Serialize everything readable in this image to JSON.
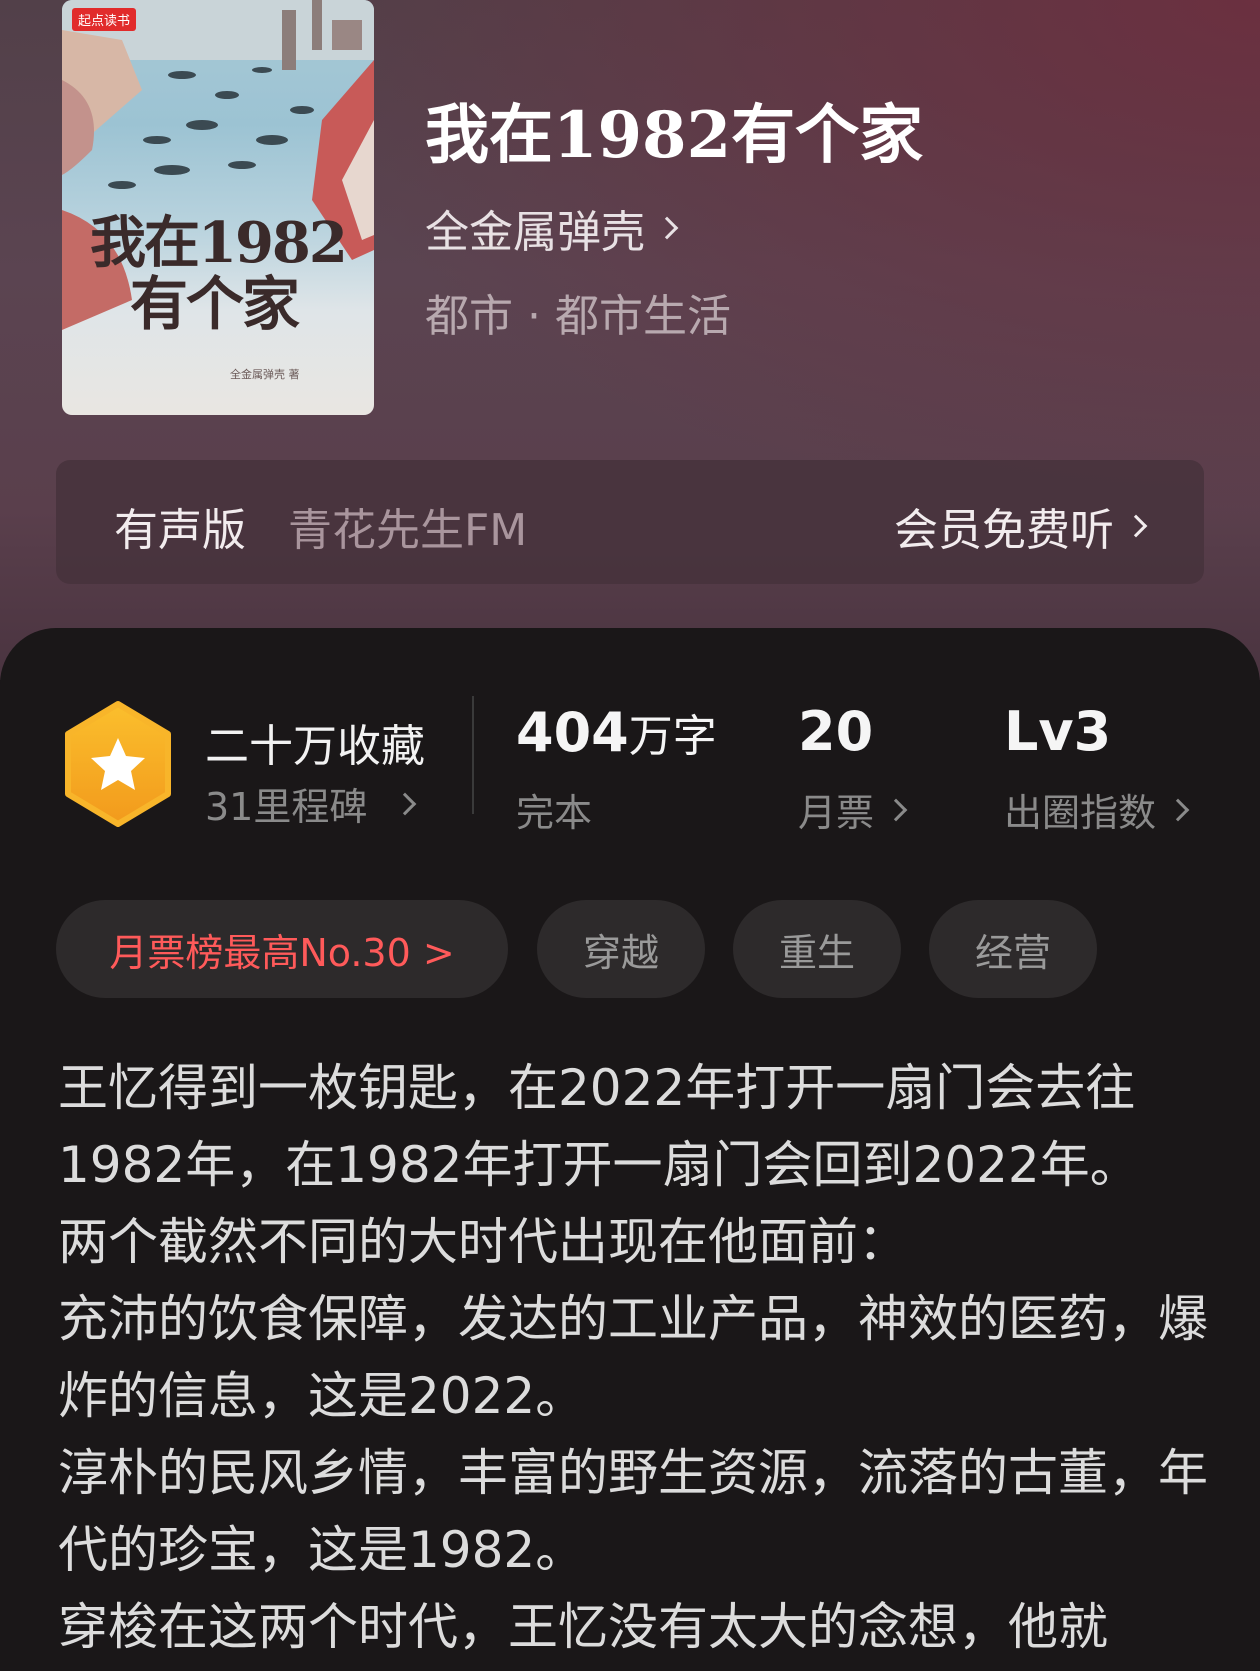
{
  "book": {
    "title": "我在1982有个家",
    "author": "全金属弹壳",
    "genre": "都市 · 都市生活",
    "cover": {
      "brand": "起点读书",
      "title_line1": "我在1982",
      "title_line2": "有个家",
      "author": "全金属弹壳 著"
    }
  },
  "audio": {
    "label": "有声版",
    "narrator": "青花先生FM",
    "action": "会员免费听"
  },
  "stats": {
    "collection": {
      "title": "二十万收藏",
      "milestones": "31里程碑"
    },
    "words": {
      "value": "404",
      "unit": "万字",
      "status": "完本"
    },
    "monthly_ticket": {
      "value": "20",
      "label": "月票"
    },
    "circle_index": {
      "value": "Lv3",
      "label": "出圈指数"
    }
  },
  "tags": {
    "rank": "月票榜最高No.30 >",
    "items": [
      "穿越",
      "重生",
      "经营"
    ]
  },
  "synopsis": [
    "王忆得到一枚钥匙，在2022年打开一扇门会去往1982年，在1982年打开一扇门会回到2022年。",
    "两个截然不同的大时代出现在他面前：",
    "充沛的饮食保障，发达的工业产品，神效的医药，爆炸的信息，这是2022。",
    "淳朴的民风乡情，丰富的野生资源，流落的古董，年代的珍宝，这是1982。",
    "穿梭在这两个时代，王忆没有太大的念想，他就"
  ],
  "colors": {
    "rank_tag": "#ff5a5a",
    "badge_orange": "#f7a928"
  },
  "icons": {
    "badge": "star-hexagon-icon",
    "chevron": "chevron-right-icon"
  }
}
